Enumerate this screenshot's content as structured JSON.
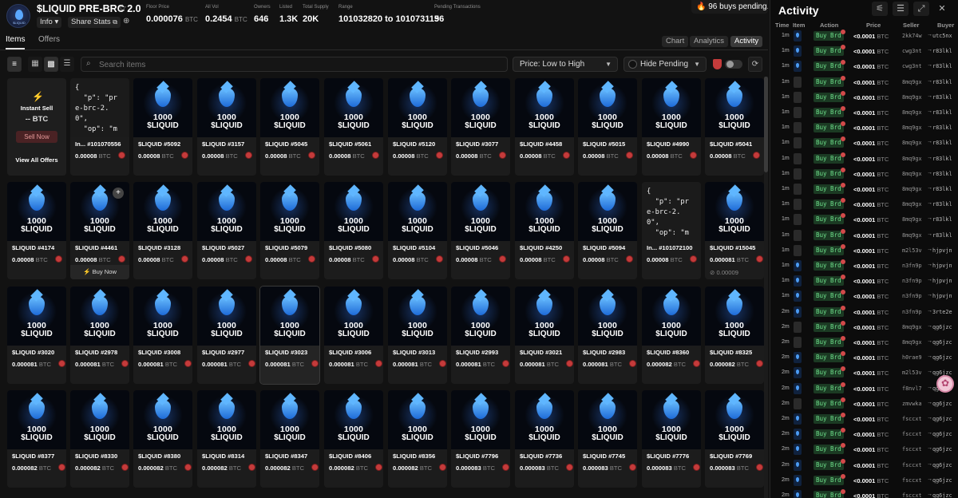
{
  "collection": {
    "title": "$LIQUID PRE-BRC 2.0",
    "logo_text": "$LIQUID",
    "info_label": "Info",
    "share_label": "Share Stats",
    "stats": [
      {
        "label": "Floor Price",
        "value": "0.000076",
        "unit": "BTC"
      },
      {
        "label": "All Vol",
        "value": "0.2454",
        "unit": "BTC"
      },
      {
        "label": "Owners",
        "value": "646",
        "unit": ""
      },
      {
        "label": "Listed",
        "value": "1.3K",
        "unit": ""
      },
      {
        "label": "Total Supply",
        "value": "20K",
        "unit": ""
      },
      {
        "label": "Range",
        "value": "101032820 to 101073115",
        "unit": ""
      },
      {
        "label": "Pending Transactions",
        "value": "96",
        "unit": ""
      }
    ],
    "pending_banner": "🔥 96 buys pending..."
  },
  "tabs": {
    "items": "Items",
    "offers": "Offers"
  },
  "views": {
    "chart": "Chart",
    "analytics": "Analytics",
    "activity": "Activity"
  },
  "toolbar": {
    "search_placeholder": "Search items",
    "sort": "Price: Low to High",
    "pending": "Hide Pending"
  },
  "instant_sell": {
    "title": "Instant Sell",
    "price": "-- BTC",
    "button": "Sell Now",
    "view_all": "View All Offers"
  },
  "art": {
    "line1": "1000",
    "line2": "$LIQUID"
  },
  "json_snippet": "{\n  \"p\": \"pr\ne-brc-2.\n0\",\n  \"op\": \"m",
  "grid": {
    "row1": [
      {
        "type": "text",
        "name": "In... #101070556",
        "price": "0.00008"
      },
      {
        "type": "art",
        "name": "$LIQUID #5092",
        "price": "0.00008"
      },
      {
        "type": "art",
        "name": "$LIQUID #3157",
        "price": "0.00008"
      },
      {
        "type": "art",
        "name": "$LIQUID #5045",
        "price": "0.00008"
      },
      {
        "type": "art",
        "name": "$LIQUID #5061",
        "price": "0.00008"
      },
      {
        "type": "art",
        "name": "$LIQUID #5120",
        "price": "0.00008"
      },
      {
        "type": "art",
        "name": "$LIQUID #3077",
        "price": "0.00008"
      },
      {
        "type": "art",
        "name": "$LIQUID #4458",
        "price": "0.00008"
      },
      {
        "type": "art",
        "name": "$LIQUID #5015",
        "price": "0.00008"
      },
      {
        "type": "art",
        "name": "$LIQUID #4990",
        "price": "0.00008"
      },
      {
        "type": "art",
        "name": "$LIQUID #5041",
        "price": "0.00008"
      }
    ],
    "row2": [
      {
        "type": "art",
        "name": "$LIQUID #4174",
        "price": "0.00008"
      },
      {
        "type": "art",
        "name": "$LIQUID #4461",
        "price": "0.00008",
        "buy_now": "Buy Now"
      },
      {
        "type": "art",
        "name": "$LIQUID #3128",
        "price": "0.00008"
      },
      {
        "type": "art",
        "name": "$LIQUID #5027",
        "price": "0.00008"
      },
      {
        "type": "art",
        "name": "$LIQUID #5079",
        "price": "0.00008"
      },
      {
        "type": "art",
        "name": "$LIQUID #5080",
        "price": "0.00008"
      },
      {
        "type": "art",
        "name": "$LIQUID #5104",
        "price": "0.00008"
      },
      {
        "type": "art",
        "name": "$LIQUID #5046",
        "price": "0.00008"
      },
      {
        "type": "art",
        "name": "$LIQUID #4250",
        "price": "0.00008"
      },
      {
        "type": "art",
        "name": "$LIQUID #5094",
        "price": "0.00008"
      },
      {
        "type": "text",
        "name": "In... #101072100",
        "price": "0.00008"
      },
      {
        "type": "art",
        "name": "$LIQUID #15045",
        "price": "0.000081",
        "sub": "0.00009"
      }
    ],
    "row3": [
      {
        "type": "art",
        "name": "$LIQUID #3020",
        "price": "0.000081"
      },
      {
        "type": "art",
        "name": "$LIQUID #2978",
        "price": "0.000081"
      },
      {
        "type": "art",
        "name": "$LIQUID #3008",
        "price": "0.000081"
      },
      {
        "type": "art",
        "name": "$LIQUID #2977",
        "price": "0.000081"
      },
      {
        "type": "art",
        "name": "$LIQUID #3023",
        "price": "0.000081"
      },
      {
        "type": "art",
        "name": "$LIQUID #3006",
        "price": "0.000081"
      },
      {
        "type": "art",
        "name": "$LIQUID #3013",
        "price": "0.000081"
      },
      {
        "type": "art",
        "name": "$LIQUID #2993",
        "price": "0.000081"
      },
      {
        "type": "art",
        "name": "$LIQUID #3021",
        "price": "0.000081"
      },
      {
        "type": "art",
        "name": "$LIQUID #2983",
        "price": "0.000081"
      },
      {
        "type": "art",
        "name": "$LIQUID #8360",
        "price": "0.000082"
      },
      {
        "type": "art",
        "name": "$LIQUID #8325",
        "price": "0.000082"
      }
    ],
    "row4": [
      {
        "type": "art",
        "name": "$LIQUID #8377",
        "price": "0.000082"
      },
      {
        "type": "art",
        "name": "$LIQUID #8330",
        "price": "0.000082"
      },
      {
        "type": "art",
        "name": "$LIQUID #8380",
        "price": "0.000082"
      },
      {
        "type": "art",
        "name": "$LIQUID #8314",
        "price": "0.000082"
      },
      {
        "type": "art",
        "name": "$LIQUID #8347",
        "price": "0.000082"
      },
      {
        "type": "art",
        "name": "$LIQUID #8406",
        "price": "0.000082"
      },
      {
        "type": "art",
        "name": "$LIQUID #8356",
        "price": "0.000082"
      },
      {
        "type": "art",
        "name": "$LIQUID #7796",
        "price": "0.000083"
      },
      {
        "type": "art",
        "name": "$LIQUID #7736",
        "price": "0.000083"
      },
      {
        "type": "art",
        "name": "$LIQUID #7745",
        "price": "0.000083"
      },
      {
        "type": "art",
        "name": "$LIQUID #7776",
        "price": "0.000083"
      },
      {
        "type": "art",
        "name": "$LIQUID #7769",
        "price": "0.000083"
      }
    ]
  },
  "unit": "BTC",
  "activity": {
    "title": "Activity",
    "headers": {
      "time": "Time",
      "item": "Item",
      "action": "Action",
      "price": "Price",
      "seller": "Seller",
      "buyer": "Buyer"
    },
    "rows": [
      {
        "time": "1m",
        "item": "art",
        "action": "Buy Brd",
        "price": "<0.0001",
        "seller": "2kk74w",
        "buyer": "utc5nx"
      },
      {
        "time": "1m",
        "item": "art",
        "action": "Buy Brd",
        "price": "<0.0001",
        "seller": "cwg3nt",
        "buyer": "r83lkl"
      },
      {
        "time": "1m",
        "item": "art",
        "action": "Buy Brd",
        "price": "<0.0001",
        "seller": "cwg3nt",
        "buyer": "r83lkl"
      },
      {
        "time": "1m",
        "item": "plain",
        "action": "Buy Brd",
        "price": "<0.0001",
        "seller": "8mq9gx",
        "buyer": "r83lkl"
      },
      {
        "time": "1m",
        "item": "plain",
        "action": "Buy Brd",
        "price": "<0.0001",
        "seller": "8mq9gx",
        "buyer": "r83lkl"
      },
      {
        "time": "1m",
        "item": "plain",
        "action": "Buy Brd",
        "price": "<0.0001",
        "seller": "8mq9gx",
        "buyer": "r83lkl"
      },
      {
        "time": "1m",
        "item": "plain",
        "action": "Buy Brd",
        "price": "<0.0001",
        "seller": "8mq9gx",
        "buyer": "r83lkl"
      },
      {
        "time": "1m",
        "item": "plain",
        "action": "Buy Brd",
        "price": "<0.0001",
        "seller": "8mq9gx",
        "buyer": "r83lkl"
      },
      {
        "time": "1m",
        "item": "plain",
        "action": "Buy Brd",
        "price": "<0.0001",
        "seller": "8mq9gx",
        "buyer": "r83lkl"
      },
      {
        "time": "1m",
        "item": "plain",
        "action": "Buy Brd",
        "price": "<0.0001",
        "seller": "8mq9gx",
        "buyer": "r83lkl"
      },
      {
        "time": "1m",
        "item": "plain",
        "action": "Buy Brd",
        "price": "<0.0001",
        "seller": "8mq9gx",
        "buyer": "r83lkl"
      },
      {
        "time": "1m",
        "item": "plain",
        "action": "Buy Brd",
        "price": "<0.0001",
        "seller": "8mq9gx",
        "buyer": "r83lkl"
      },
      {
        "time": "1m",
        "item": "plain",
        "action": "Buy Brd",
        "price": "<0.0001",
        "seller": "8mq9gx",
        "buyer": "r83lkl"
      },
      {
        "time": "1m",
        "item": "plain",
        "action": "Buy Brd",
        "price": "<0.0001",
        "seller": "8mq9gx",
        "buyer": "r83lkl"
      },
      {
        "time": "1m",
        "item": "plain",
        "action": "Buy Brd",
        "price": "<0.0001",
        "seller": "m2l53v",
        "buyer": "hjpvjn"
      },
      {
        "time": "1m",
        "item": "art",
        "action": "Buy Brd",
        "price": "<0.0001",
        "seller": "n3fn9p",
        "buyer": "hjpvjn"
      },
      {
        "time": "1m",
        "item": "art",
        "action": "Buy Brd",
        "price": "<0.0001",
        "seller": "n3fn9p",
        "buyer": "hjpvjn"
      },
      {
        "time": "1m",
        "item": "art",
        "action": "Buy Brd",
        "price": "<0.0001",
        "seller": "n3fn9p",
        "buyer": "hjpvjn"
      },
      {
        "time": "2m",
        "item": "art",
        "action": "Buy Brd",
        "price": "<0.0001",
        "seller": "n3fn9p",
        "buyer": "3rte2e"
      },
      {
        "time": "2m",
        "item": "plain",
        "action": "Buy Brd",
        "price": "<0.0001",
        "seller": "8mq9gx",
        "buyer": "qg6jzc"
      },
      {
        "time": "2m",
        "item": "plain",
        "action": "Buy Brd",
        "price": "<0.0001",
        "seller": "8mq9gx",
        "buyer": "qg6jzc"
      },
      {
        "time": "2m",
        "item": "art",
        "action": "Buy Brd",
        "price": "<0.0001",
        "seller": "h0rae9",
        "buyer": "qg6jzc"
      },
      {
        "time": "2m",
        "item": "art",
        "action": "Buy Brd",
        "price": "<0.0001",
        "seller": "m2l53v",
        "buyer": "qg6jzc"
      },
      {
        "time": "2m",
        "item": "art",
        "action": "Buy Brd",
        "price": "<0.0001",
        "seller": "f8nvl7",
        "buyer": "qg6jzc"
      },
      {
        "time": "2m",
        "item": "plain",
        "action": "Buy Brd",
        "price": "<0.0001",
        "seller": "zmvwka",
        "buyer": "qg6jzc"
      },
      {
        "time": "2m",
        "item": "art",
        "action": "Buy Brd",
        "price": "<0.0001",
        "seller": "fsccxt",
        "buyer": "qg6jzc"
      },
      {
        "time": "2m",
        "item": "art",
        "action": "Buy Brd",
        "price": "<0.0001",
        "seller": "fsccxt",
        "buyer": "qg6jzc"
      },
      {
        "time": "2m",
        "item": "art",
        "action": "Buy Brd",
        "price": "<0.0001",
        "seller": "fsccxt",
        "buyer": "qg6jzc"
      },
      {
        "time": "2m",
        "item": "art",
        "action": "Buy Brd",
        "price": "<0.0001",
        "seller": "fsccxt",
        "buyer": "qg6jzc"
      },
      {
        "time": "2m",
        "item": "art",
        "action": "Buy Brd",
        "price": "<0.0001",
        "seller": "fsccxt",
        "buyer": "qg6jzc"
      },
      {
        "time": "2m",
        "item": "art",
        "action": "Buy Brd",
        "price": "<0.0001",
        "seller": "fsccxt",
        "buyer": "qg6jzc"
      }
    ]
  },
  "colors": {
    "accent_green": "#6fe28c",
    "bg": "#121212",
    "badge_red": "#c43b3b",
    "drop_blue": "#4b9cf5"
  },
  "icons": [
    "logo-icon",
    "star-icon",
    "chevron-down-icon",
    "share-icon",
    "globe-icon",
    "filter-icon",
    "grid-large-icon",
    "grid-small-icon",
    "list-icon",
    "search-icon",
    "refresh-icon",
    "toggle-icon",
    "shield-icon",
    "bolt-icon",
    "plus-icon",
    "sliders-icon",
    "list-view-icon",
    "expand-icon",
    "close-icon"
  ]
}
